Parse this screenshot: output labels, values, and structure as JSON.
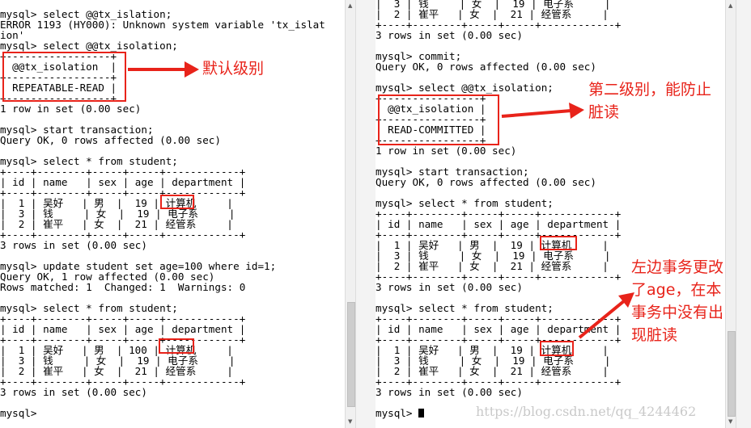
{
  "left_terminal": {
    "lines": [
      "mysql> select @@tx_islation;",
      "ERROR 1193 (HY000): Unknown system variable 'tx_islat",
      "ion'",
      "mysql> select @@tx_isolation;",
      "+-----------------+",
      "| @@tx_isolation  |",
      "+-----------------+",
      "| REPEATABLE-READ |",
      "+-----------------+",
      "1 row in set (0.00 sec)",
      "",
      "mysql> start transaction;",
      "Query OK, 0 rows affected (0.00 sec)",
      "",
      "mysql> select * from student;",
      "+----+--------+-----+-----+------------+",
      "| id | name   | sex | age | department |",
      "+----+--------+-----+-----+------------+",
      "|  1 | 吴好   | 男  |  19 | 计算机     |",
      "|  3 | 钱     | 女  |  19 | 电子系     |",
      "|  2 | 崔平   | 女  |  21 | 经管系     |",
      "+----+--------+-----+-----+------------+",
      "3 rows in set (0.00 sec)",
      "",
      "mysql> update student set age=100 where id=1;",
      "Query OK, 1 row affected (0.00 sec)",
      "Rows matched: 1  Changed: 1  Warnings: 0",
      "",
      "mysql> select * from student;",
      "+----+--------+-----+-----+------------+",
      "| id | name   | sex | age | department |",
      "+----+--------+-----+-----+------------+",
      "|  1 | 吴好   | 男  | 100 | 计算机     |",
      "|  3 | 钱     | 女  |  19 | 电子系     |",
      "|  2 | 崔平   | 女  |  21 | 经管系     |",
      "+----+--------+-----+-----+------------+",
      "3 rows in set (0.00 sec)",
      "",
      "mysql>"
    ]
  },
  "right_terminal": {
    "lines": [
      "|  3 | 钱     | 女  |  19 | 电子系     |",
      "|  2 | 崔平   | 女  |  21 | 经管系     |",
      "+----+--------+-----+-----+------------+",
      "3 rows in set (0.00 sec)",
      "",
      "mysql> commit;",
      "Query OK, 0 rows affected (0.00 sec)",
      "",
      "mysql> select @@tx_isolation;",
      "+----------------+",
      "| @@tx_isolation |",
      "+----------------+",
      "| READ-COMMITTED |",
      "+----------------+",
      "1 row in set (0.00 sec)",
      "",
      "mysql> start transaction;",
      "Query OK, 0 rows affected (0.00 sec)",
      "",
      "mysql> select * from student;",
      "+----+--------+-----+-----+------------+",
      "| id | name   | sex | age | department |",
      "+----+--------+-----+-----+------------+",
      "|  1 | 吴好   | 男  |  19 | 计算机     |",
      "|  3 | 钱     | 女  |  19 | 电子系     |",
      "|  2 | 崔平   | 女  |  21 | 经管系     |",
      "+----+--------+-----+-----+------------+",
      "3 rows in set (0.00 sec)",
      "",
      "mysql> select * from student;",
      "+----+--------+-----+-----+------------+",
      "| id | name   | sex | age | department |",
      "+----+--------+-----+-----+------------+",
      "|  1 | 吴好   | 男  |  19 | 计算机     |",
      "|  3 | 钱     | 女  |  19 | 电子系     |",
      "|  2 | 崔平   | 女  |  21 | 经管系     |",
      "+----+--------+-----+-----+------------+",
      "3 rows in set (0.00 sec)",
      "",
      "mysql> "
    ]
  },
  "annotations": {
    "default_level": "默认级别",
    "second_level_1": "第二级别，能防止",
    "second_level_2": "脏读",
    "left_changed_1": "左边事务更改",
    "left_changed_2": "了age，在本",
    "left_changed_3": "事务中没有出",
    "left_changed_4": "现脏读"
  },
  "watermark": "https://blog.csdn.net/qq_4244462",
  "colors": {
    "highlight": "#e8231a",
    "terminal_bg": "#ffffff",
    "terminal_text": "#000000"
  }
}
